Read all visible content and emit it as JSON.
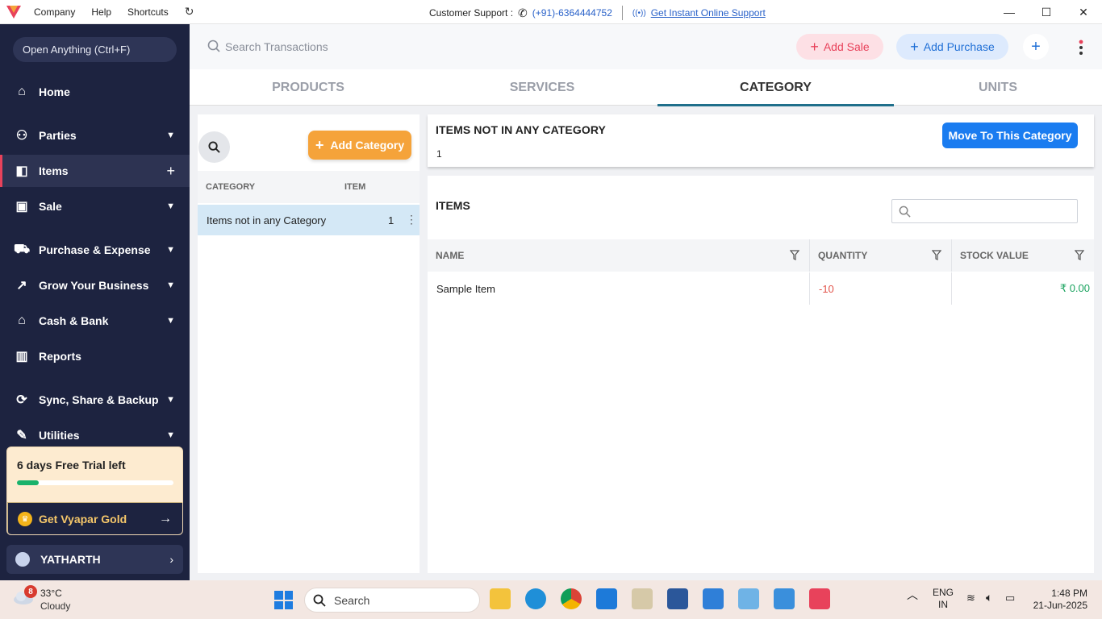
{
  "titlebar": {
    "menus": [
      "Company",
      "Help",
      "Shortcuts"
    ],
    "support_label": "Customer Support :",
    "support_phone": "(+91)-6364444752",
    "online_support": "Get Instant Online Support"
  },
  "sidebar": {
    "open_anything": "Open Anything (Ctrl+F)",
    "items": [
      {
        "label": "Home",
        "icon": "home-icon"
      },
      {
        "label": "Parties",
        "icon": "users-icon"
      },
      {
        "label": "Items",
        "icon": "bag-icon"
      },
      {
        "label": "Sale",
        "icon": "receipt-icon"
      },
      {
        "label": "Purchase & Expense",
        "icon": "cart-icon"
      },
      {
        "label": "Grow Your Business",
        "icon": "trend-icon"
      },
      {
        "label": "Cash & Bank",
        "icon": "bank-icon"
      },
      {
        "label": "Reports",
        "icon": "bar-chart-icon"
      },
      {
        "label": "Sync, Share & Backup",
        "icon": "sync-icon"
      },
      {
        "label": "Utilities",
        "icon": "wrench-icon"
      }
    ],
    "trial_text": "6 days Free Trial left",
    "trial_progress": 0.14,
    "gold_label": "Get Vyapar Gold",
    "user_name": "YATHARTH"
  },
  "topbar": {
    "search_placeholder": "Search Transactions",
    "add_sale": "Add Sale",
    "add_purchase": "Add Purchase"
  },
  "tabs": [
    "PRODUCTS",
    "SERVICES",
    "CATEGORY",
    "UNITS"
  ],
  "left_panel": {
    "add_category": "Add Category",
    "col_category": "CATEGORY",
    "col_item": "ITEM",
    "rows": [
      {
        "name": "Items not in any Category",
        "count": "1"
      }
    ]
  },
  "right_panel": {
    "header_title": "ITEMS NOT IN ANY CATEGORY",
    "header_count": "1",
    "move_button": "Move To This Category",
    "items_title": "ITEMS",
    "columns": [
      "NAME",
      "QUANTITY",
      "STOCK VALUE"
    ],
    "rows": [
      {
        "name": "Sample Item",
        "quantity": "-10",
        "stock_value": "₹ 0.00"
      }
    ]
  },
  "taskbar": {
    "weather_badge": "8",
    "temperature": "33°C",
    "condition": "Cloudy",
    "search": "Search",
    "lang1": "ENG",
    "lang2": "IN",
    "time": "1:48 PM",
    "date": "21-Jun-2025"
  },
  "colors": {
    "sidebar_bg": "#1d2340",
    "accent_red": "#e8425b",
    "accent_blue": "#1a7cf0",
    "add_category": "#f5a33a",
    "negative_qty": "#e2534a",
    "stock_value": "#1aa35f"
  }
}
